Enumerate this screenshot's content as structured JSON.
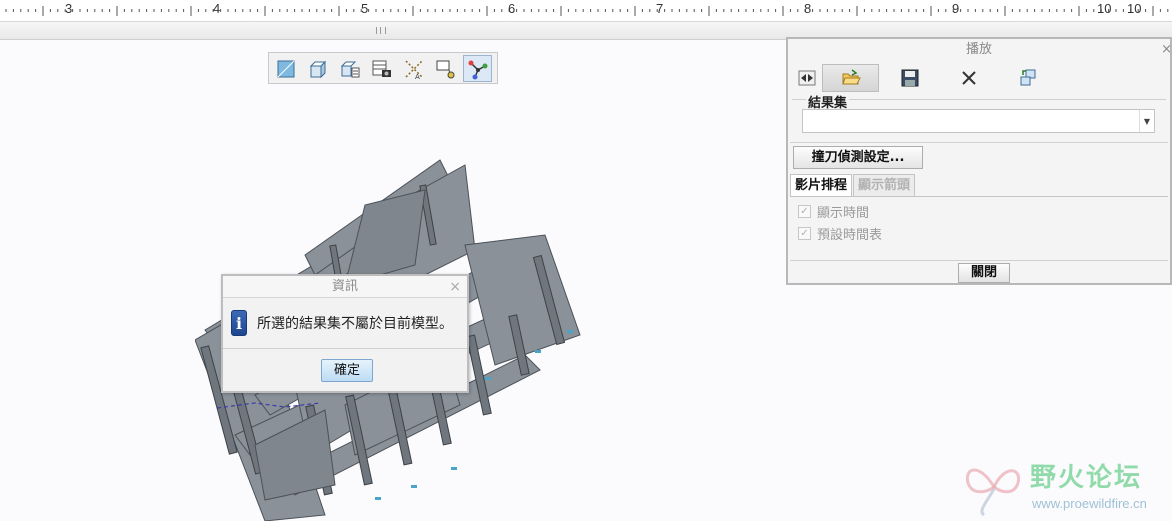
{
  "ruler": {
    "numbers": [
      "3",
      "4",
      "5",
      "6",
      "7",
      "8",
      "9",
      "10",
      "10"
    ]
  },
  "toolbar": {
    "icons": [
      "plane-view-icon",
      "cube-view-icon",
      "cube-list-icon",
      "table-camera-icon",
      "axes-icon",
      "flag-icon",
      "path-nodes-icon"
    ]
  },
  "info_dialog": {
    "title": "資訊",
    "close": "×",
    "icon_glyph": "i",
    "message": "所選的結果集不屬於目前模型。",
    "ok_label": "確定"
  },
  "playback": {
    "title": "播放",
    "close": "×",
    "toolbar_icons": [
      "step-icon",
      "open-folder-icon",
      "save-icon",
      "delete-icon",
      "transfer-icon"
    ],
    "result_set_label": "結果集",
    "result_set_value": "",
    "collision_button": "撞刀偵測設定...",
    "tabs": [
      {
        "label": "影片排程",
        "active": true
      },
      {
        "label": "顯示箭頭",
        "active": false
      }
    ],
    "checkboxes": [
      {
        "label": "顯示時間",
        "checked": true
      },
      {
        "label": "預設時間表",
        "checked": true
      }
    ],
    "close_button": "關閉"
  },
  "watermark": {
    "title": "野火论坛",
    "url": "www.proewildfire.cn"
  }
}
